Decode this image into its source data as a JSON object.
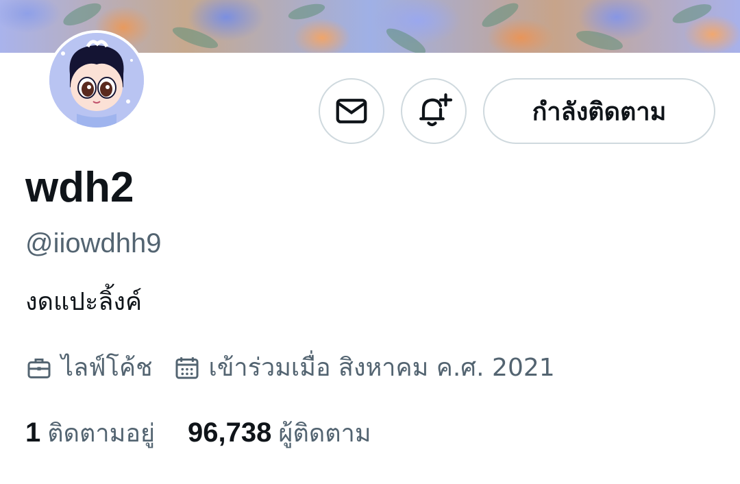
{
  "profile": {
    "display_name": "wdh2",
    "handle": "@iiowdhh9",
    "bio": "งดแปะลิ้งค์",
    "category": "ไลฟ์โค้ช",
    "joined": "เข้าร่วมเมื่อ สิงหาคม ค.ศ. 2021"
  },
  "actions": {
    "message_icon": "envelope-icon",
    "notify_icon": "bell-plus-icon",
    "follow_label": "กำลังติดตาม"
  },
  "stats": {
    "following_count": "1",
    "following_label": "ติดตามอยู่",
    "followers_count": "96,738",
    "followers_label": "ผู้ติดตาม"
  },
  "colors": {
    "text_primary": "#0f1419",
    "text_secondary": "#536471",
    "border": "#cfd9de"
  }
}
